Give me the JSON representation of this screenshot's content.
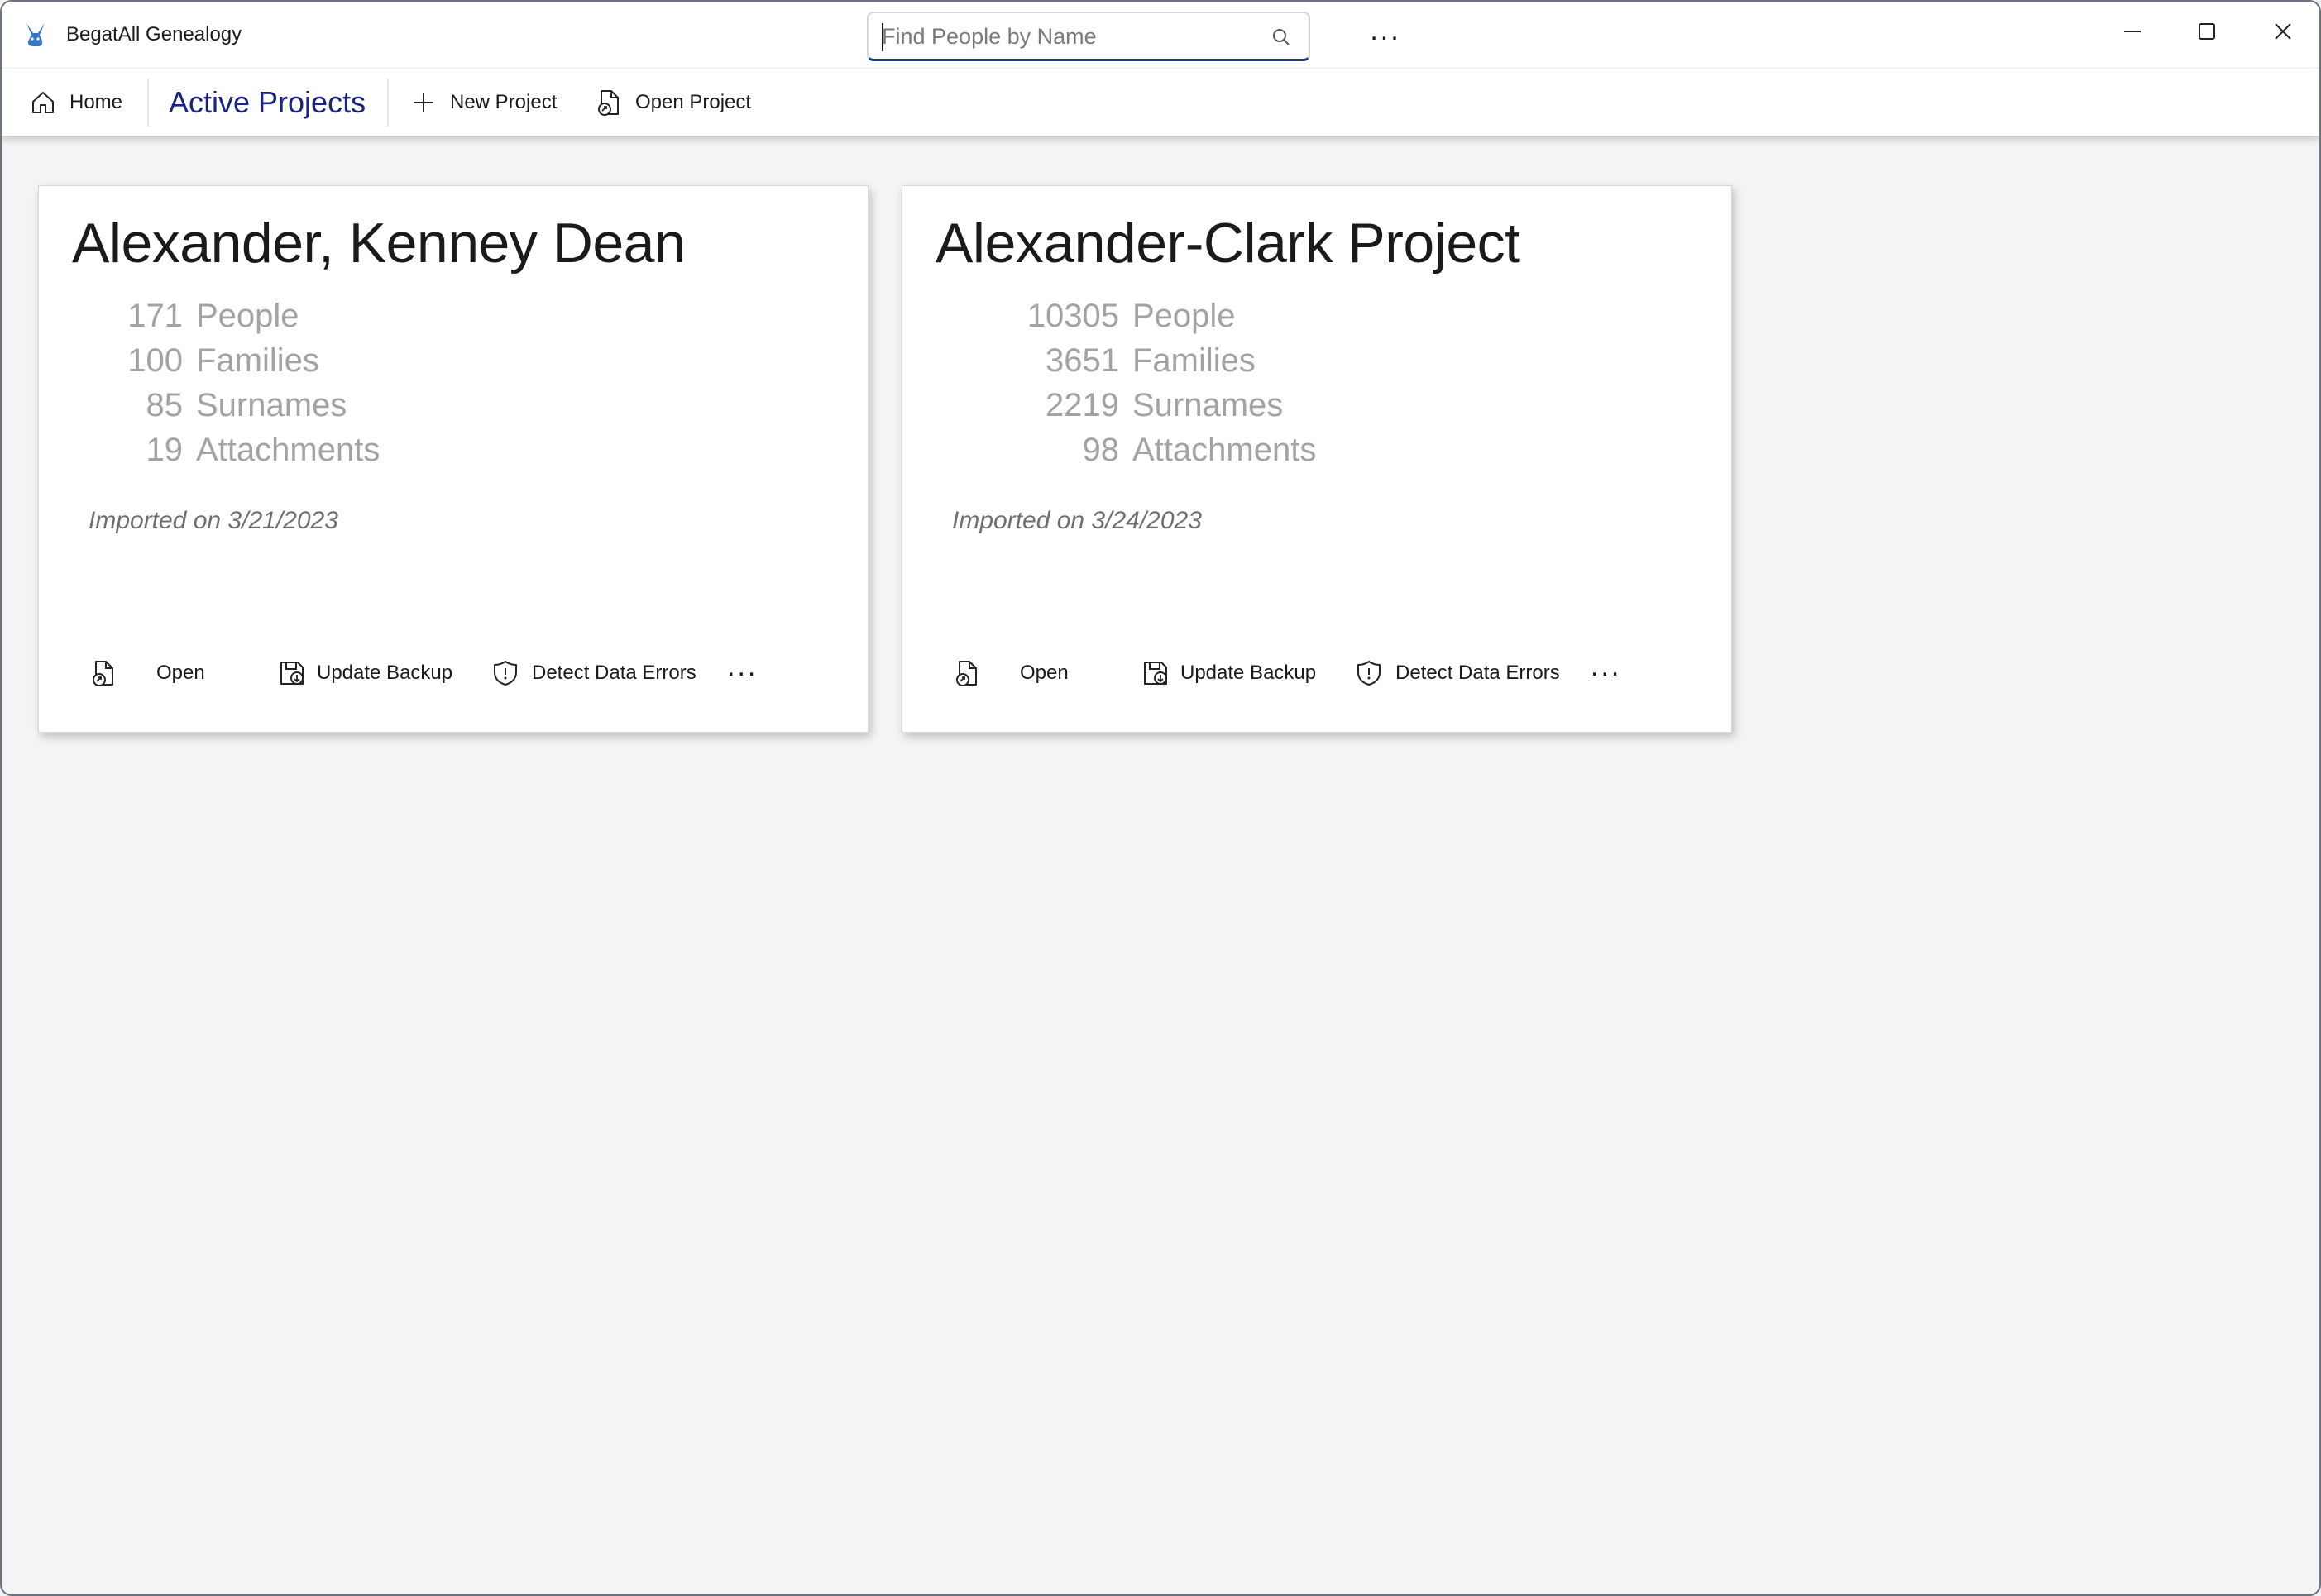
{
  "app": {
    "title": "BegatAll Genealogy",
    "accent_color": "#1a237e",
    "logo_icon": "rabbit-logo-icon"
  },
  "search": {
    "placeholder": "Find People by Name",
    "value": "",
    "icon": "search-icon"
  },
  "titlebar": {
    "more_label": "...",
    "window_controls": [
      "minimize",
      "maximize",
      "close"
    ]
  },
  "toolbar": {
    "home_label": "Home",
    "active_label": "Active Projects",
    "new_label": "New Project",
    "open_label": "Open Project"
  },
  "projects": [
    {
      "title": "Alexander, Kenney Dean",
      "stats": [
        {
          "num": "171",
          "label": "People"
        },
        {
          "num": "100",
          "label": "Families"
        },
        {
          "num": "85",
          "label": "Surnames"
        },
        {
          "num": "19",
          "label": "Attachments"
        }
      ],
      "imported": "Imported on 3/21/2023",
      "actions": {
        "open": "Open",
        "backup": "Update Backup",
        "detect": "Detect Data Errors",
        "more": "..."
      }
    },
    {
      "title": "Alexander-Clark Project",
      "stats": [
        {
          "num": "10305",
          "label": "People"
        },
        {
          "num": "3651",
          "label": "Families"
        },
        {
          "num": "2219",
          "label": "Surnames"
        },
        {
          "num": "98",
          "label": "Attachments"
        }
      ],
      "imported": "Imported on 3/24/2023",
      "actions": {
        "open": "Open",
        "backup": "Update Backup",
        "detect": "Detect Data Errors",
        "more": "..."
      }
    }
  ]
}
